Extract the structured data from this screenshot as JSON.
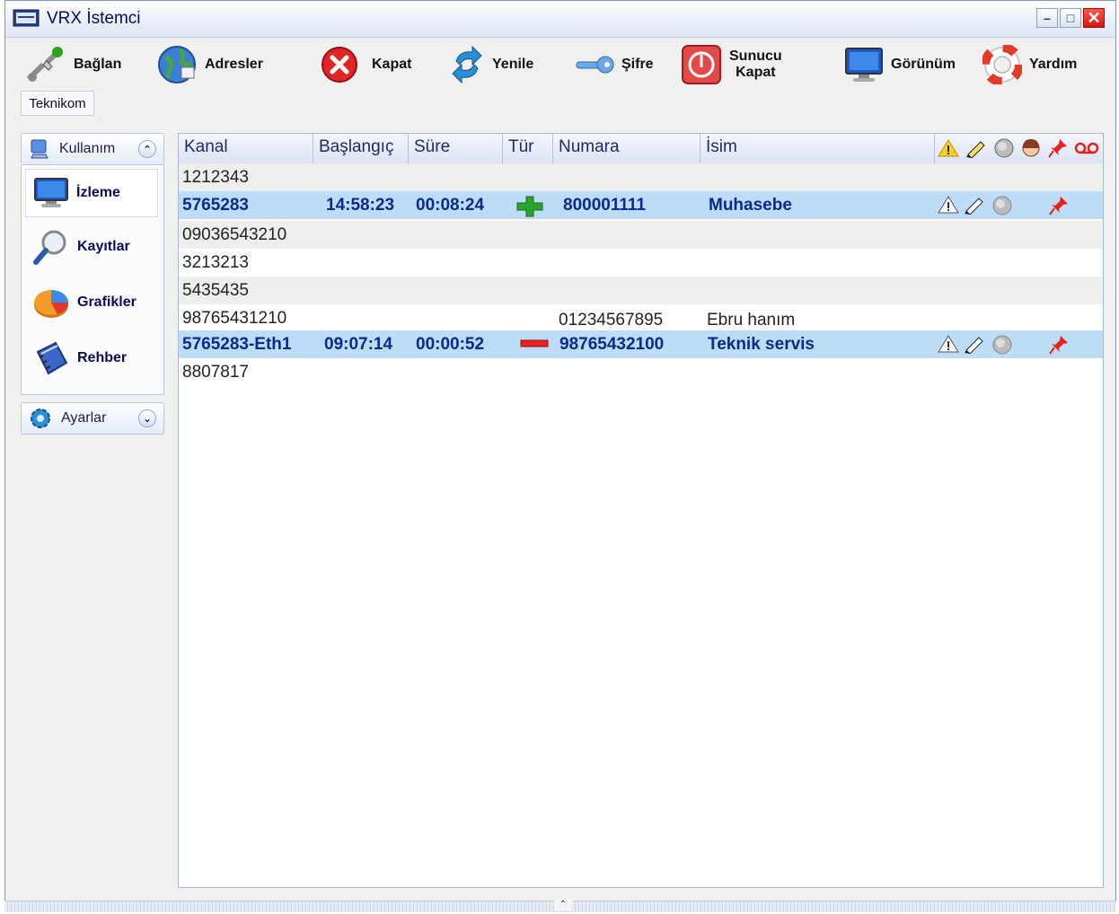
{
  "window": {
    "title": "VRX İstemci"
  },
  "toolbar": {
    "items": [
      {
        "label": "Bağlan",
        "icon": "connect-icon"
      },
      {
        "label": "Adresler",
        "icon": "globe-icon"
      },
      {
        "label": "Kapat",
        "icon": "close-circle-icon"
      },
      {
        "label": "Yenile",
        "icon": "refresh-icon"
      },
      {
        "label": "Şifre",
        "icon": "key-icon"
      },
      {
        "label_line1": "Sunucu",
        "label_line2": "Kapat",
        "icon": "power-icon"
      },
      {
        "label": "Görünüm",
        "icon": "monitor-icon"
      },
      {
        "label": "Yardım",
        "icon": "lifebuoy-icon"
      }
    ]
  },
  "tab": {
    "label": "Teknikom"
  },
  "sidebar": {
    "kullanim": {
      "label": "Kullanım",
      "items": [
        {
          "label": "İzleme",
          "icon": "monitor-icon",
          "active": true
        },
        {
          "label": "Kayıtlar",
          "icon": "magnifier-icon"
        },
        {
          "label": "Grafikler",
          "icon": "pie-chart-icon"
        },
        {
          "label": "Rehber",
          "icon": "phonebook-icon"
        }
      ]
    },
    "ayarlar": {
      "label": "Ayarlar"
    }
  },
  "grid": {
    "columns": [
      "Kanal",
      "Başlangıç",
      "Süre",
      "Tür",
      "Numara",
      "İsim"
    ],
    "header_icons": [
      "warning-icon",
      "pen-icon",
      "speaker-icon",
      "agent-icon",
      "pin-icon",
      "voicemail-icon"
    ],
    "rows": [
      {
        "kanal": "1212343",
        "baslangic": "",
        "sure": "",
        "tur": "",
        "numara": "",
        "isim": "",
        "style": "alt"
      },
      {
        "kanal": "5765283",
        "baslangic": "14:58:23",
        "sure": "00:08:24",
        "tur": "incoming",
        "numara": "800001111",
        "isim": "Muhasebe",
        "style": "sel"
      },
      {
        "kanal": "09036543210",
        "baslangic": "",
        "sure": "",
        "tur": "",
        "numara": "",
        "isim": "",
        "style": "alt"
      },
      {
        "kanal": "3213213",
        "baslangic": "",
        "sure": "",
        "tur": "",
        "numara": "",
        "isim": "",
        "style": "plain"
      },
      {
        "kanal": "5435435",
        "baslangic": "",
        "sure": "",
        "tur": "",
        "numara": "",
        "isim": "",
        "style": "alt"
      },
      {
        "kanal": "98765431210",
        "baslangic": "",
        "sure": "",
        "tur": "",
        "numara": "01234567895",
        "isim": "Ebru hanım",
        "style": "plain"
      },
      {
        "kanal": "5765283-Eth1",
        "baslangic": "09:07:14",
        "sure": "00:00:52",
        "tur": "outgoing",
        "numara": "98765432100",
        "isim": "Teknik servis",
        "style": "sel"
      },
      {
        "kanal": "8807817",
        "baslangic": "",
        "sure": "",
        "tur": "",
        "numara": "",
        "isim": "",
        "style": "plain"
      }
    ]
  },
  "colors": {
    "selected_row": "#bcdcf7",
    "alt_row": "#eeeeec",
    "title_text": "#0a0a5a"
  }
}
